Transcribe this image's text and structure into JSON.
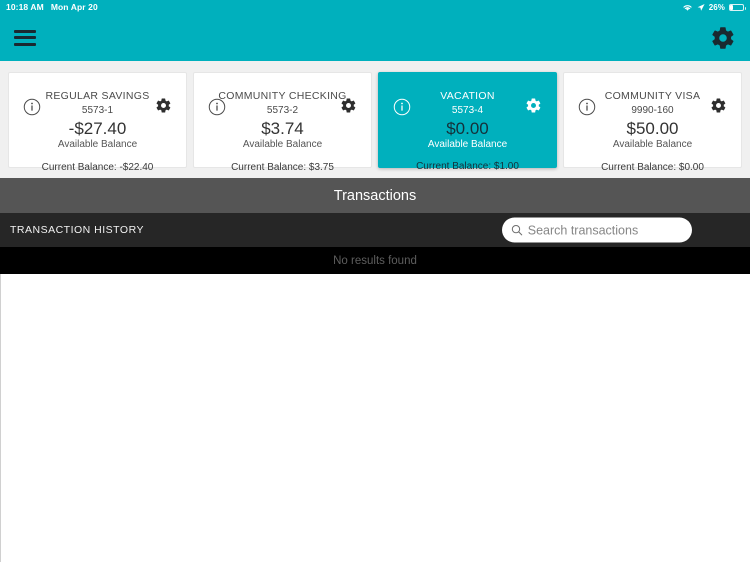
{
  "status_bar": {
    "time": "10:18 AM",
    "date": "Mon Apr 20",
    "battery_percent": "26%",
    "wifi_icon": "wifi-icon",
    "location_icon": "location-arrow-icon",
    "battery_icon": "battery-icon"
  },
  "header": {
    "menu_icon": "hamburger-menu-icon",
    "settings_icon": "gear-icon",
    "background_color": "#00b0bd"
  },
  "accounts": [
    {
      "name": "REGULAR SAVINGS",
      "number": "5573-1",
      "available_balance": "-$27.40",
      "available_label": "Available Balance",
      "current_balance": "Current Balance: -$22.40",
      "selected": false,
      "info_icon": "info-circle-icon",
      "gear_icon": "gear-icon"
    },
    {
      "name": "COMMUNITY CHECKING",
      "number": "5573-2",
      "available_balance": "$3.74",
      "available_label": "Available Balance",
      "current_balance": "Current Balance: $3.75",
      "selected": false,
      "info_icon": "info-circle-icon",
      "gear_icon": "gear-icon"
    },
    {
      "name": "VACATION",
      "number": "5573-4",
      "available_balance": "$0.00",
      "available_label": "Available Balance",
      "current_balance": "Current Balance: $1.00",
      "selected": true,
      "info_icon": "info-circle-icon",
      "gear_icon": "gear-icon"
    },
    {
      "name": "COMMUNITY VISA",
      "number": "9990-160",
      "available_balance": "$50.00",
      "available_label": "Available Balance",
      "current_balance": "Current Balance: $0.00",
      "selected": false,
      "info_icon": "info-circle-icon",
      "gear_icon": "gear-icon"
    }
  ],
  "transactions": {
    "title": "Transactions",
    "history_label": "TRANSACTION HISTORY",
    "search_placeholder": "Search transactions",
    "search_value": "",
    "search_icon": "search-icon",
    "empty_message": "No results found"
  }
}
